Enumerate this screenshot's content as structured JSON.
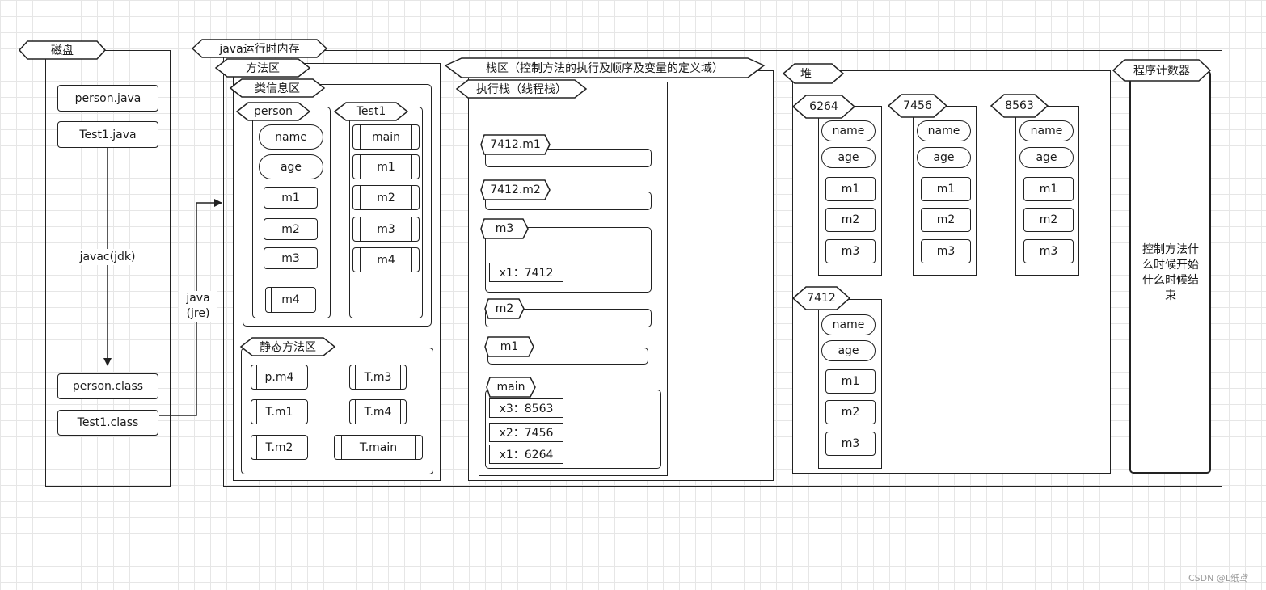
{
  "disk": {
    "title": "磁盘",
    "files": [
      "person.java",
      "Test1.java",
      "person.class",
      "Test1.class"
    ],
    "compile_label": "javac(jdk)",
    "run_label_line1": "java",
    "run_label_line2": "(jre)"
  },
  "memory": {
    "title": "java运行时内存",
    "method_area": {
      "title": "方法区",
      "class_info": {
        "title": "类信息区",
        "person": {
          "title": "person",
          "fields": [
            "name",
            "age"
          ],
          "methods": [
            "m1",
            "m2",
            "m3"
          ],
          "static_method": "m4"
        },
        "test1": {
          "title": "Test1",
          "methods": [
            "main",
            "m1",
            "m2",
            "m3",
            "m4"
          ]
        }
      },
      "static_area": {
        "title": "静态方法区",
        "items": [
          "p.m4",
          "T.m3",
          "T.m1",
          "T.m4",
          "T.m2",
          "T.main"
        ]
      }
    },
    "stack": {
      "title": "栈区（控制方法的执行及顺序及变量的定义域）",
      "exec_stack": {
        "title": "执行栈（线程栈）",
        "frames": {
          "f1": "7412.m1",
          "f2": "7412.m2",
          "f3": "m3",
          "f3_var": "x1：7412",
          "f4": "m2",
          "f5": "m1",
          "main": "main",
          "main_vars": [
            "x3：8563",
            "x2：7456",
            "x1：6264"
          ]
        }
      }
    },
    "heap": {
      "title": "堆",
      "objects": [
        {
          "addr": "6264",
          "fields": [
            "name",
            "age"
          ],
          "methods": [
            "m1",
            "m2",
            "m3"
          ]
        },
        {
          "addr": "7456",
          "fields": [
            "name",
            "age"
          ],
          "methods": [
            "m1",
            "m2",
            "m3"
          ]
        },
        {
          "addr": "8563",
          "fields": [
            "name",
            "age"
          ],
          "methods": [
            "m1",
            "m2",
            "m3"
          ]
        },
        {
          "addr": "7412",
          "fields": [
            "name",
            "age"
          ],
          "methods": [
            "m1",
            "m2",
            "m3"
          ]
        }
      ]
    },
    "pc": {
      "title": "程序计数器",
      "desc_lines": [
        "控制方法什",
        "么时候开始",
        "什么时候结",
        "束"
      ]
    }
  },
  "watermark": "CSDN @L纸鸢"
}
